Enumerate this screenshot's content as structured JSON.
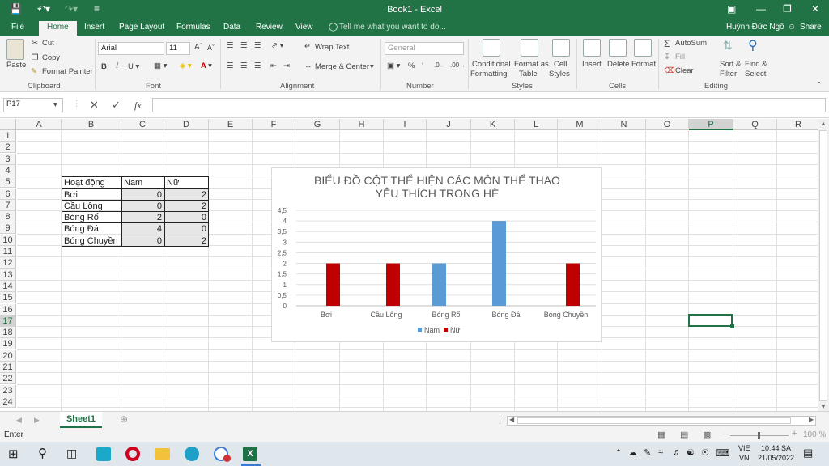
{
  "window": {
    "title": "Book1 - Excel",
    "user": "Huỳnh Đức Ngô",
    "share": "Share"
  },
  "tabs": [
    "File",
    "Home",
    "Insert",
    "Page Layout",
    "Formulas",
    "Data",
    "Review",
    "View"
  ],
  "tell_me": "Tell me what you want to do...",
  "ribbon": {
    "paste": "Paste",
    "cut": "Cut",
    "copy": "Copy",
    "format_painter": "Format Painter",
    "font_name": "Arial",
    "font_size": "11",
    "wrap_text": "Wrap Text",
    "merge_center": "Merge & Center",
    "number_format": "General",
    "conditional_formatting_1": "Conditional",
    "conditional_formatting_2": "Formatting",
    "format_as_table_1": "Format as",
    "format_as_table_2": "Table",
    "cell_styles_1": "Cell",
    "cell_styles_2": "Styles",
    "insert": "Insert",
    "delete": "Delete",
    "format": "Format",
    "autosum": "AutoSum",
    "fill": "Fill",
    "clear": "Clear",
    "sort_filter_1": "Sort &",
    "sort_filter_2": "Filter",
    "find_select_1": "Find &",
    "find_select_2": "Select",
    "groups": [
      "Clipboard",
      "Font",
      "Alignment",
      "Number",
      "Styles",
      "Cells",
      "Editing"
    ]
  },
  "formula_bar": {
    "name_box": "P17",
    "fx": "fx",
    "value": ""
  },
  "columns": [
    "A",
    "B",
    "C",
    "D",
    "E",
    "F",
    "G",
    "H",
    "I",
    "J",
    "K",
    "L",
    "M",
    "N",
    "O",
    "P",
    "Q",
    "R"
  ],
  "rows": [
    "1",
    "2",
    "3",
    "4",
    "5",
    "6",
    "7",
    "8",
    "9",
    "10",
    "11",
    "12",
    "13",
    "14",
    "15",
    "16",
    "17",
    "18",
    "19",
    "20",
    "21",
    "22",
    "23",
    "24"
  ],
  "table": {
    "headers": [
      "Hoạt động",
      "Nam",
      "Nữ"
    ],
    "rows": [
      [
        "Bơi",
        "0",
        "2"
      ],
      [
        "Cầu Lông",
        "0",
        "2"
      ],
      [
        "Bóng Rổ",
        "2",
        "0"
      ],
      [
        "Bóng Đá",
        "4",
        "0"
      ],
      [
        "Bóng Chuyền",
        "0",
        "2"
      ]
    ]
  },
  "chart_data": {
    "type": "bar",
    "title": "BIỂU ĐỒ CỘT THỂ HIỆN CÁC MÔN THỂ THAO YÊU THÍCH TRONG HÈ",
    "title_lines": [
      "BIỂU ĐỒ CỘT THỂ HIỆN CÁC MÔN THỂ THAO",
      "YÊU THÍCH TRONG HÈ"
    ],
    "categories": [
      "Bơi",
      "Cầu Lông",
      "Bóng Rổ",
      "Bóng Đá",
      "Bóng Chuyền"
    ],
    "series": [
      {
        "name": "Nam",
        "values": [
          0,
          0,
          2,
          4,
          0
        ],
        "color": "#5b9bd5"
      },
      {
        "name": "Nữ",
        "values": [
          2,
          2,
          0,
          0,
          2
        ],
        "color": "#c00000"
      }
    ],
    "yticks": [
      "0",
      "0,5",
      "1",
      "1,5",
      "2",
      "2,5",
      "3",
      "3,5",
      "4",
      "4,5"
    ],
    "ylim": [
      0,
      4.5
    ],
    "grid": true,
    "legend": "bottom"
  },
  "sheet": {
    "name": "Sheet1"
  },
  "status": {
    "mode": "Enter",
    "zoom": "100 %"
  },
  "taskbar": {
    "lang1": "VIE",
    "lang2": "VN",
    "time": "10:44 SA",
    "date": "21/05/2022"
  }
}
